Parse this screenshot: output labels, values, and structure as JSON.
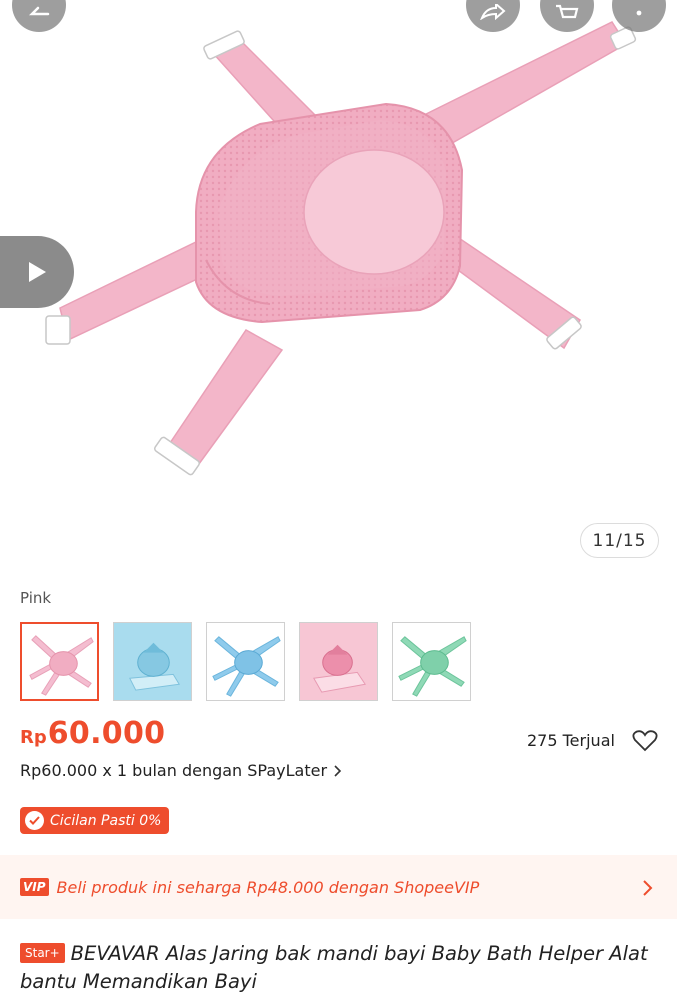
{
  "gallery": {
    "counter": "11/15",
    "icons": [
      "back-arrow-icon",
      "share-icon",
      "cart-icon",
      "more-icon",
      "play-icon"
    ]
  },
  "variant": {
    "label": "Pink",
    "options": [
      {
        "name": "pink",
        "color": "#f4bdd0"
      },
      {
        "name": "blue-seat",
        "color": "#9fd6ea"
      },
      {
        "name": "blue",
        "color": "#8fcbec"
      },
      {
        "name": "pink-seat",
        "color": "#f29fb6"
      },
      {
        "name": "green",
        "color": "#8fd9b6"
      }
    ],
    "selected_index": 0
  },
  "price": {
    "currency": "Rp",
    "amount": "60.000",
    "sold": "275 Terjual",
    "paylater": "Rp60.000 x 1 bulan dengan SPayLater",
    "installment_badge": "Cicilan Pasti 0%"
  },
  "vip": {
    "badge": "VIP",
    "text": "Beli produk ini seharga Rp48.000 dengan ShopeeVIP"
  },
  "product": {
    "badge": "Star+",
    "title": "BEVAVAR Alas Jaring bak mandi bayi Baby Bath Helper Alat bantu Memandikan Bayi"
  },
  "colors": {
    "accent": "#ee4d2d",
    "product_pink": "#f3b6c9",
    "vip_bg": "#fff5f1"
  }
}
